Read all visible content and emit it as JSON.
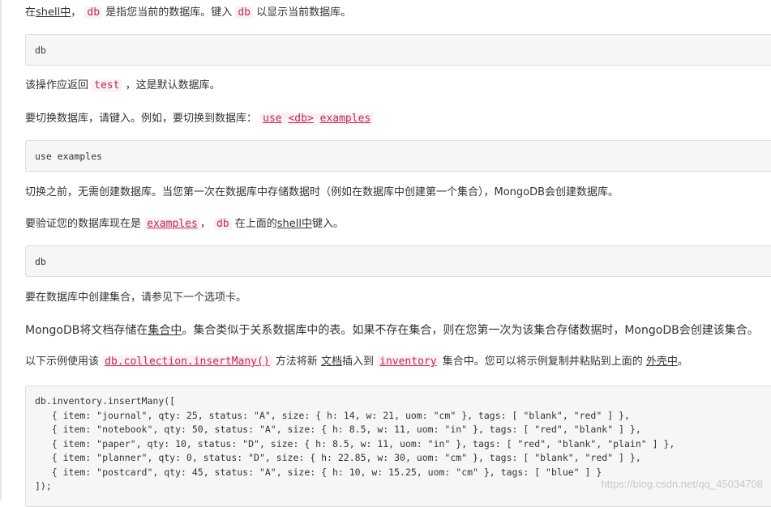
{
  "p1": {
    "a": "在",
    "shell": "shell中",
    "b": "，",
    "code_db": "db",
    "c": "是指您当前的数据库。键入",
    "code_db2": "db",
    "d": "以显示当前数据库。"
  },
  "box1": {
    "code": "db"
  },
  "p2": {
    "a": "该操作应返回",
    "code_test": "test",
    "b": "，这是默认数据库。"
  },
  "p3": {
    "a": "要切换数据库，请键入。例如，要切换到数据库：",
    "code_use": "use",
    "code_db": "<db>",
    "code_examples": "examples"
  },
  "box2": {
    "code": "use examples"
  },
  "p4": {
    "text": "切换之前，无需创建数据库。当您第一次在数据库中存储数据时（例如在数据库中创建第一个集合），MongoDB会创建数据库。"
  },
  "p5": {
    "a": "要验证您的数据库现在是",
    "code_examples": "examples",
    "b": "，",
    "code_db": "db",
    "c": "在上面的",
    "shell": "shell中",
    "d": "键入。"
  },
  "box3": {
    "code": "db"
  },
  "p6": {
    "text": "要在数据库中创建集合，请参见下一个选项卡。"
  },
  "p7": {
    "a": "MongoDB将文档存储在",
    "link": "集合中",
    "b": "。集合类似于关系数据库中的表。如果不存在集合，则在您第一次为该集合存储数据时，MongoDB会创建该集合。"
  },
  "p8": {
    "a": "以下示例使用该",
    "code_method": "db.collection.insertMany()",
    "b": "方法将新",
    "link_doc": "文档",
    "c": "插入到",
    "code_inventory": "inventory",
    "d": "集合中。您可以将示例复制并粘贴到上面的",
    "link_shell": "外壳中",
    "e": "。"
  },
  "box4": {
    "lines": [
      "db.inventory.insertMany([",
      "   { item: \"journal\", qty: 25, status: \"A\", size: { h: 14, w: 21, uom: \"cm\" }, tags: [ \"blank\", \"red\" ] },",
      "   { item: \"notebook\", qty: 50, status: \"A\", size: { h: 8.5, w: 11, uom: \"in\" }, tags: [ \"red\", \"blank\" ] },",
      "   { item: \"paper\", qty: 10, status: \"D\", size: { h: 8.5, w: 11, uom: \"in\" }, tags: [ \"red\", \"blank\", \"plain\" ] },",
      "   { item: \"planner\", qty: 0, status: \"D\", size: { h: 22.85, w: 30, uom: \"cm\" }, tags: [ \"blank\", \"red\" ] },",
      "   { item: \"postcard\", qty: 45, status: \"A\", size: { h: 10, w: 15.25, uom: \"cm\" }, tags: [ \"blue\" ] }",
      "]);"
    ]
  },
  "watermark": "https://blog.csdn.net/qq_45034708"
}
